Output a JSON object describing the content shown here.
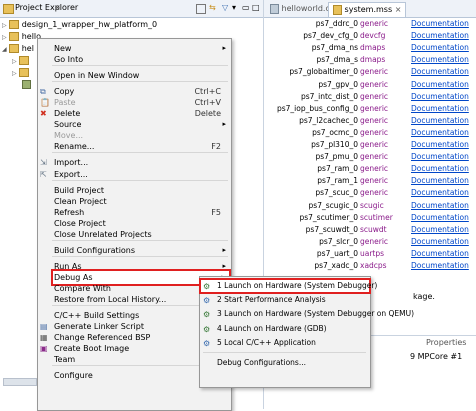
{
  "project_explorer": {
    "title": "Project Explorer",
    "tree": [
      {
        "label": "design_1_wrapper_hw_platform_0"
      },
      {
        "label": "hello"
      },
      {
        "label": "hel"
      }
    ]
  },
  "editor": {
    "tabs": [
      {
        "label": "helloworld.c"
      },
      {
        "label": "system.mss"
      }
    ],
    "rows": [
      {
        "name": "ps7_ddrc_0",
        "type": "generic",
        "doc": "Documentation"
      },
      {
        "name": "ps7_dev_cfg_0",
        "type": "devcfg",
        "doc": "Documentation"
      },
      {
        "name": "ps7_dma_ns",
        "type": "dmaps",
        "doc": "Documentation"
      },
      {
        "name": "ps7_dma_s",
        "type": "dmaps",
        "doc": "Documentation"
      },
      {
        "name": "ps7_globaltimer_0",
        "type": "generic",
        "doc": "Documentation"
      },
      {
        "name": "ps7_gpv_0",
        "type": "generic",
        "doc": "Documentation"
      },
      {
        "name": "ps7_intc_dist_0",
        "type": "generic",
        "doc": "Documentation"
      },
      {
        "name": "ps7_iop_bus_config_0",
        "type": "generic",
        "doc": "Documentation"
      },
      {
        "name": "ps7_l2cachec_0",
        "type": "generic",
        "doc": "Documentation"
      },
      {
        "name": "ps7_ocmc_0",
        "type": "generic",
        "doc": "Documentation"
      },
      {
        "name": "ps7_pl310_0",
        "type": "generic",
        "doc": "Documentation"
      },
      {
        "name": "ps7_pmu_0",
        "type": "generic",
        "doc": "Documentation"
      },
      {
        "name": "ps7_ram_0",
        "type": "generic",
        "doc": "Documentation"
      },
      {
        "name": "ps7_ram_1",
        "type": "generic",
        "doc": "Documentation"
      },
      {
        "name": "ps7_scuc_0",
        "type": "generic",
        "doc": "Documentation"
      },
      {
        "name": "ps7_scugic_0",
        "type": "scugic",
        "doc": "Documentation"
      },
      {
        "name": "ps7_scutimer_0",
        "type": "scutimer",
        "doc": "Documentation"
      },
      {
        "name": "ps7_scuwdt_0",
        "type": "scuwdt",
        "doc": "Documentation"
      },
      {
        "name": "ps7_slcr_0",
        "type": "generic",
        "doc": "Documentation"
      },
      {
        "name": "ps7_uart_0",
        "type": "uartps",
        "doc": "Documentation"
      },
      {
        "name": "ps7_xadc_0",
        "type": "xadcps",
        "doc": "Documentation"
      }
    ],
    "bottom_fragments": {
      "package": "kage.",
      "properties": "Properties",
      "mpcore": "9 MPCore #1"
    }
  },
  "context_menu": {
    "items": [
      {
        "label": "New",
        "submenu": true
      },
      {
        "label": "Go Into"
      },
      {
        "sep": true
      },
      {
        "label": "Open in New Window"
      },
      {
        "sep": true
      },
      {
        "label": "Copy",
        "shortcut": "Ctrl+C",
        "icon": "copy-icon"
      },
      {
        "label": "Paste",
        "shortcut": "Ctrl+V",
        "icon": "paste-icon",
        "disabled": true
      },
      {
        "label": "Delete",
        "shortcut": "Delete",
        "icon": "delete-icon"
      },
      {
        "label": "Source",
        "submenu": true
      },
      {
        "label": "Move...",
        "disabled": true
      },
      {
        "label": "Rename...",
        "shortcut": "F2"
      },
      {
        "sep": true
      },
      {
        "label": "Import...",
        "icon": "import-icon"
      },
      {
        "label": "Export...",
        "icon": "export-icon"
      },
      {
        "sep": true
      },
      {
        "label": "Build Project"
      },
      {
        "label": "Clean Project"
      },
      {
        "label": "Refresh",
        "shortcut": "F5"
      },
      {
        "label": "Close Project"
      },
      {
        "label": "Close Unrelated Projects"
      },
      {
        "sep": true
      },
      {
        "label": "Build Configurations",
        "submenu": true
      },
      {
        "sep": true
      },
      {
        "label": "Run As",
        "submenu": true
      },
      {
        "label": "Debug As",
        "submenu": true,
        "highlight": true
      },
      {
        "label": "Compare With",
        "submenu": true
      },
      {
        "label": "Restore from Local History..."
      },
      {
        "sep": true
      },
      {
        "label": "C/C++ Build Settings"
      },
      {
        "label": "Generate Linker Script",
        "icon": "linker-icon"
      },
      {
        "label": "Change Referenced BSP",
        "icon": "bsp-icon"
      },
      {
        "label": "Create Boot Image",
        "icon": "boot-icon"
      },
      {
        "label": "Team",
        "submenu": true
      },
      {
        "sep": true
      },
      {
        "label": "Configure",
        "submenu": true
      }
    ]
  },
  "submenu": {
    "items": [
      {
        "label": "1 Launch on Hardware (System Debugger)",
        "highlight": true
      },
      {
        "label": "2 Start Performance Analysis"
      },
      {
        "label": "3 Launch on Hardware (System Debugger on QEMU)"
      },
      {
        "label": "4 Launch on Hardware (GDB)"
      },
      {
        "label": "5 Local C/C++ Application"
      },
      {
        "sep": true
      },
      {
        "label": "Debug Configurations..."
      }
    ]
  },
  "colors": {
    "highlight_outline": "#e02020",
    "type_text": "#8a1a8a",
    "doc_link": "#0046c8"
  }
}
